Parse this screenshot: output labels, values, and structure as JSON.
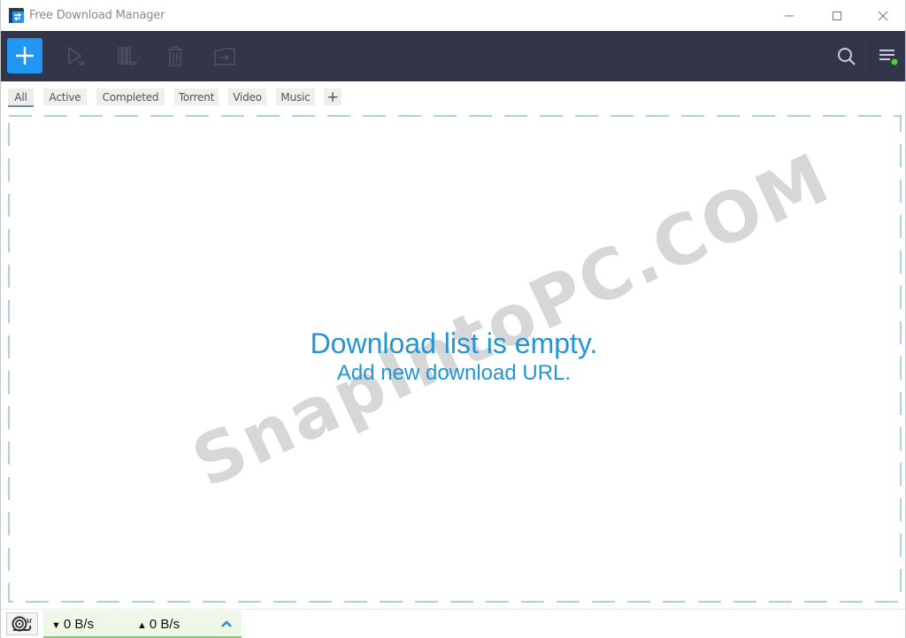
{
  "window": {
    "title": "Free Download Manager",
    "controls": {
      "minimize": "minimize",
      "maximize": "maximize",
      "close": "close"
    }
  },
  "toolbar": {
    "buttons": [
      {
        "name": "add-download",
        "icon": "plus-icon",
        "enabled": true
      },
      {
        "name": "start",
        "icon": "play-icon",
        "enabled": false
      },
      {
        "name": "pause",
        "icon": "pause-icon",
        "enabled": false
      },
      {
        "name": "delete",
        "icon": "trash-icon",
        "enabled": false
      },
      {
        "name": "move-to-folder",
        "icon": "folder-icon",
        "enabled": false
      },
      {
        "name": "search",
        "icon": "search-icon",
        "enabled": true
      },
      {
        "name": "main-menu",
        "icon": "menu-icon",
        "enabled": true
      }
    ],
    "accent": "#2196f3",
    "background": "#33364b",
    "status_dot_color": "#4cd137"
  },
  "tabs": [
    {
      "label": "All",
      "active": true
    },
    {
      "label": "Active",
      "active": false
    },
    {
      "label": "Completed",
      "active": false
    },
    {
      "label": "Torrent",
      "active": false
    },
    {
      "label": "Video",
      "active": false
    },
    {
      "label": "Music",
      "active": false
    }
  ],
  "tabs_add_label": "+",
  "empty_state": {
    "title": "Download list is empty.",
    "link": "Add new download URL.",
    "color": "#2196d3"
  },
  "watermark": "SnapIntoPC.COM",
  "status": {
    "download_speed": "0 B/s",
    "upload_speed": "0 B/s",
    "down_arrow": "▼",
    "up_arrow": "▲"
  }
}
